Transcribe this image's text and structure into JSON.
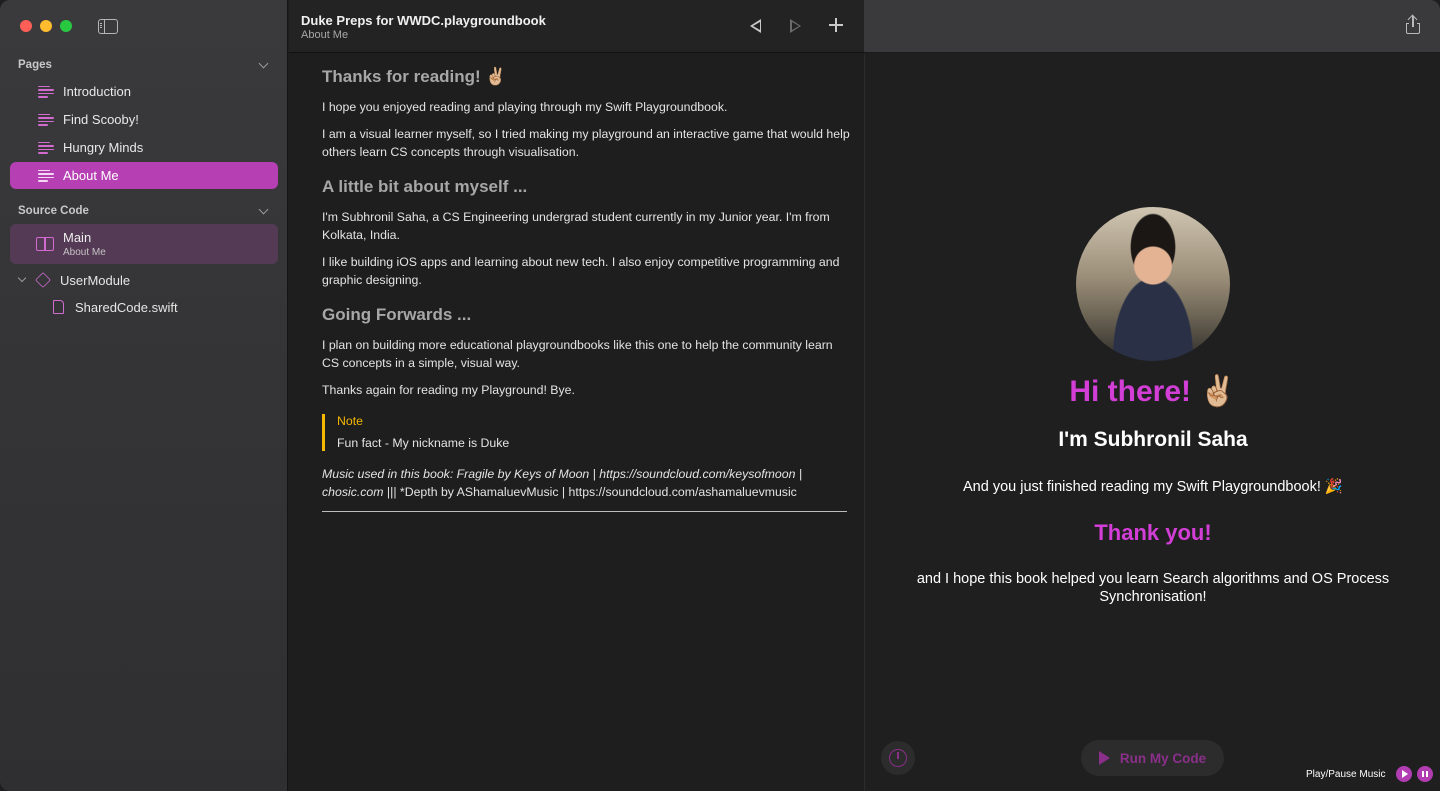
{
  "window": {
    "title": "Duke Preps for WWDC.playgroundbook",
    "subtitle": "About Me"
  },
  "sidebar": {
    "pages_header": "Pages",
    "pages": [
      {
        "label": "Introduction"
      },
      {
        "label": "Find Scooby!"
      },
      {
        "label": "Hungry Minds"
      },
      {
        "label": "About Me",
        "selected": true
      }
    ],
    "source_header": "Source Code",
    "source_main": {
      "title": "Main",
      "subtitle": "About Me"
    },
    "module": "UserModule",
    "shared_file": "SharedCode.swift"
  },
  "doc": {
    "h1": "Thanks for reading! ✌🏼",
    "p1": "I hope you enjoyed reading and playing through my Swift Playgroundbook.",
    "p2": "I am a visual learner myself, so I tried making my playground an interactive game that would help others learn CS concepts through visualisation.",
    "h2": "A little bit about myself ...",
    "p3": "I'm Subhronil Saha, a CS Engineering undergrad student currently in my Junior year. I'm from Kolkata, India.",
    "p4": "I like building iOS apps and learning about new tech. I also enjoy competitive programming and graphic designing.",
    "h3": "Going Forwards ...",
    "p5": "I plan on building more educational playgroundbooks like this one to help the community learn CS concepts in a simple, visual way.",
    "p6": "Thanks again for reading my Playground! Bye.",
    "note_label": "Note",
    "note_text": "Fun fact - My nickname is Duke",
    "credits_italic": "Music used in this book: Fragile by Keys of Moon | https://soundcloud.com/keysofmoon | chosic.com",
    "credits_plain": " ||| *Depth by AShamaluevMusic | https://soundcloud.com/ashamaluevmusic"
  },
  "live": {
    "hi": "Hi there! ✌🏼",
    "name": "I'm Subhronil Saha",
    "finished": "And you just finished reading my Swift Playgroundbook! 🎉",
    "thanks": "Thank you!",
    "hope": "and I hope this book helped you learn Search algorithms and OS Process Synchronisation!",
    "run_label": "Run My Code",
    "music_label": "Play/Pause Music"
  },
  "colors": {
    "accent": "#b53fb3",
    "highlight": "#d23ed6",
    "note": "#f5b700"
  }
}
